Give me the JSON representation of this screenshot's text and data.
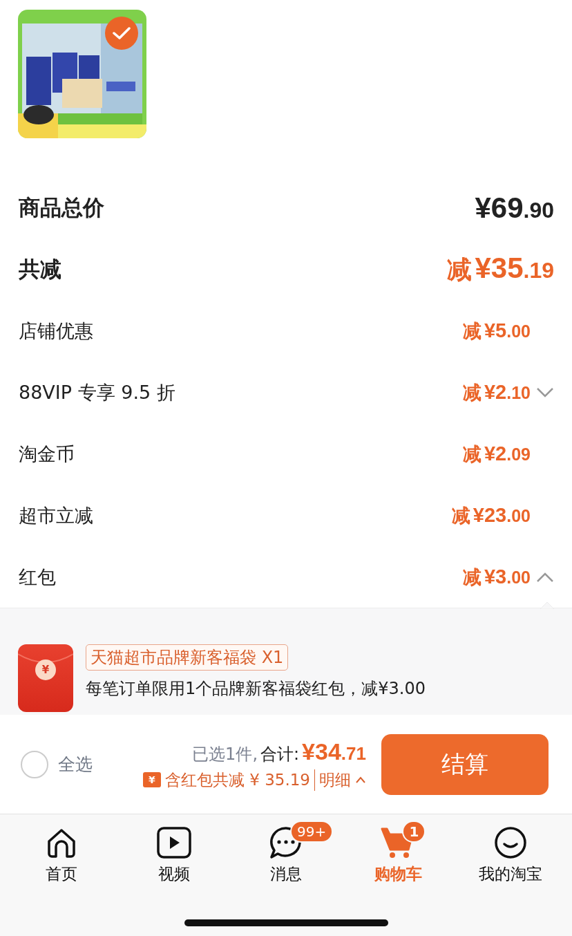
{
  "product": {
    "kind": "picture",
    "selected": true
  },
  "summary": [
    {
      "kind": "total",
      "label": "商品总价",
      "amount": "¥69.90"
    },
    {
      "kind": "discount_total",
      "label": "共减",
      "prefix": "减",
      "amount": "¥35.19"
    },
    {
      "kind": "discount",
      "label": "店铺优惠",
      "prefix": "减",
      "amount": "¥5.00"
    },
    {
      "kind": "discount",
      "label": "88VIP 专享 9.5 折",
      "prefix": "减",
      "amount": "¥2.10",
      "expanded": false
    },
    {
      "kind": "discount",
      "label": "淘金币",
      "prefix": "减",
      "amount": "¥2.09"
    },
    {
      "kind": "discount",
      "label": "超市立减",
      "prefix": "减",
      "amount": "¥23.00"
    },
    {
      "kind": "discount",
      "label": "红包",
      "prefix": "减",
      "amount": "¥3.00",
      "expanded": true
    }
  ],
  "coupon": {
    "glyph": "¥",
    "tag": "天猫超市品牌新客福袋 X1",
    "description": "每笔订单限用1个品牌新客福袋红包，减¥3.00"
  },
  "checkout": {
    "select_all": {
      "label": "全选",
      "checked": false
    },
    "selected_count": "已选1件,",
    "total_label": "合计:",
    "total": "¥34.71",
    "savings_glyph": "¥",
    "savings": "含红包共减 ¥ 35.19",
    "details": "明细",
    "details_expanded": true,
    "button": "结算"
  },
  "tabs": [
    {
      "kind": "home",
      "label": "首页",
      "selected": false
    },
    {
      "kind": "video",
      "label": "视频",
      "selected": false
    },
    {
      "kind": "message",
      "label": "消息",
      "selected": false,
      "badge": "99+"
    },
    {
      "kind": "cart",
      "label": "购物车",
      "selected": true,
      "badge": "1"
    },
    {
      "kind": "smile",
      "label": "我的淘宝",
      "selected": false
    }
  ]
}
